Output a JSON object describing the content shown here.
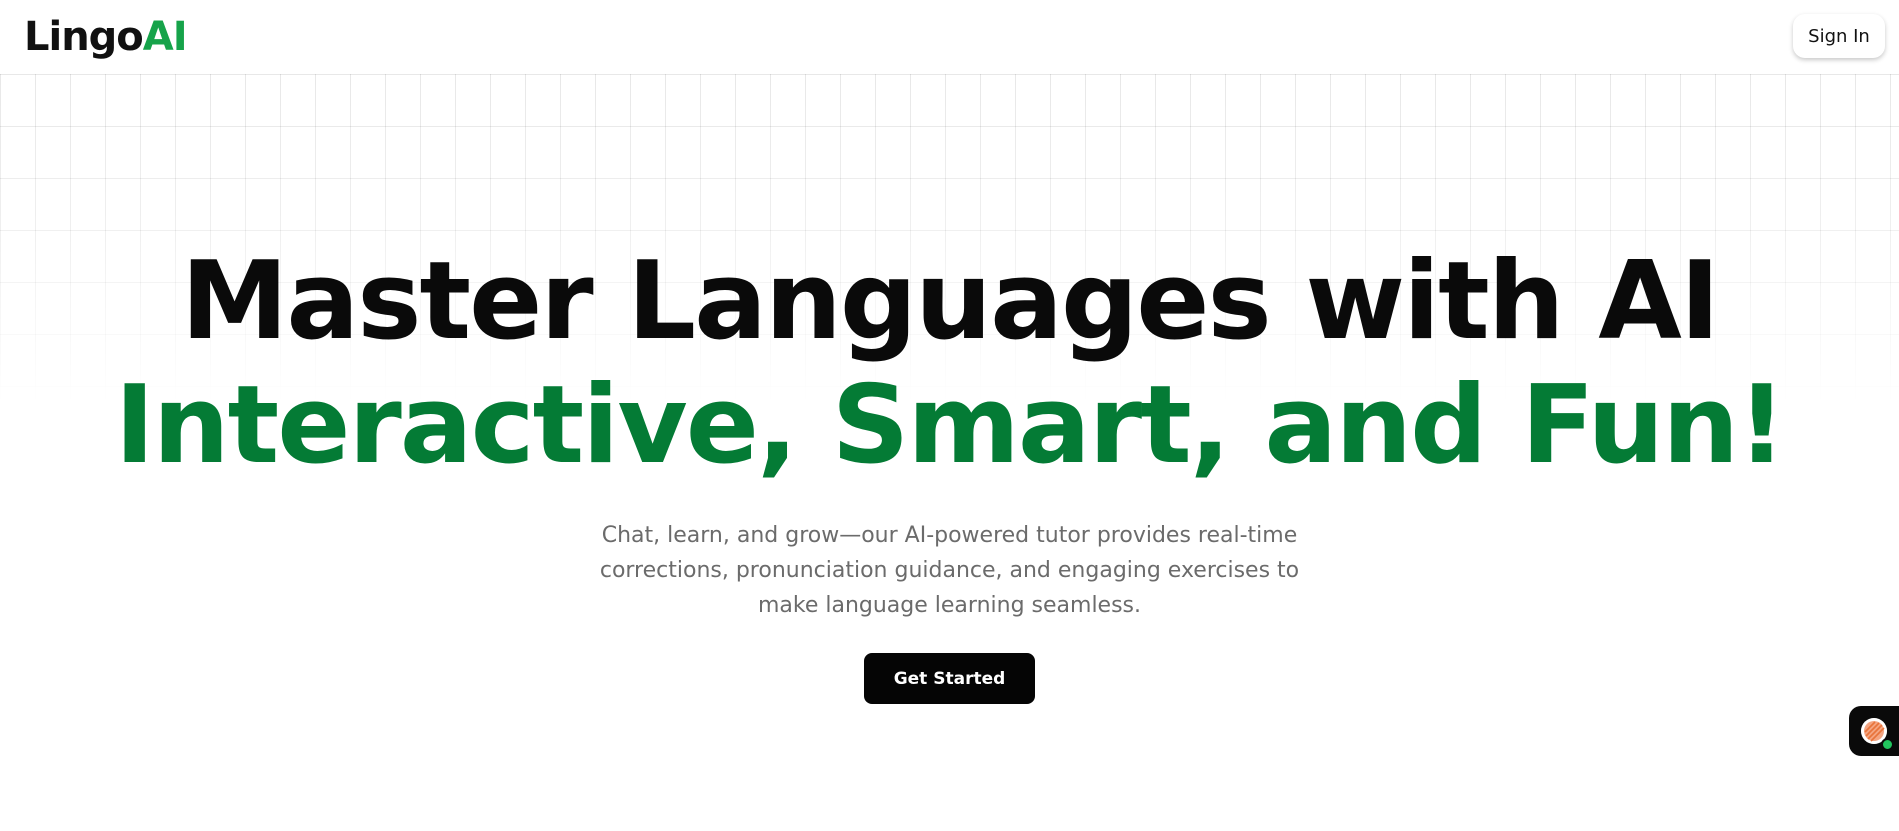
{
  "header": {
    "logo_part1": "Lingo",
    "logo_part2": "AI",
    "signin_label": "Sign In"
  },
  "hero": {
    "headline_line1": "Master Languages with AI",
    "headline_line2": "Interactive, Smart, and Fun!",
    "subtext": "Chat, learn, and grow—our AI-powered tutor provides real-time corrections, pronunciation guidance, and engaging exercises to make language learning seamless.",
    "cta_label": "Get Started"
  },
  "chat_widget": {
    "icon": "chat-avatar-icon",
    "status": "online"
  },
  "colors": {
    "brand_green": "#16a34a",
    "headline_green": "#047b35",
    "primary_dark": "#050505",
    "subtext_gray": "#6b6b6b"
  }
}
